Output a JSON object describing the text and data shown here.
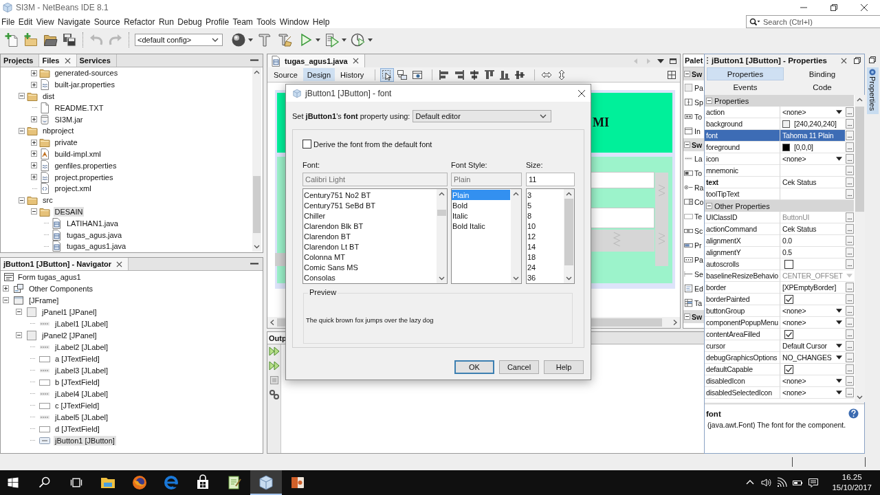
{
  "window": {
    "title": "SI3M - NetBeans IDE 8.1"
  },
  "menu": [
    "File",
    "Edit",
    "View",
    "Navigate",
    "Source",
    "Refactor",
    "Run",
    "Debug",
    "Profile",
    "Team",
    "Tools",
    "Window",
    "Help"
  ],
  "search": {
    "placeholder": "Search (Ctrl+I)"
  },
  "toolbar": {
    "groups": [
      [
        {
          "kind": "new-file",
          "disabled": false
        },
        {
          "kind": "new-project",
          "disabled": false
        },
        {
          "kind": "open-project",
          "disabled": false
        },
        {
          "kind": "save-all",
          "disabled": false
        }
      ],
      [
        {
          "kind": "undo",
          "disabled": true
        },
        {
          "kind": "redo",
          "disabled": true
        }
      ]
    ],
    "config": "<default config>",
    "tools": [
      {
        "kind": "globe",
        "menu": true
      },
      {
        "kind": "build",
        "menu": false
      },
      {
        "kind": "clean-build",
        "menu": false
      },
      {
        "kind": "run",
        "menu": true
      },
      {
        "kind": "debug",
        "menu": true
      },
      {
        "kind": "profile",
        "menu": true
      }
    ]
  },
  "projects": {
    "tabs": [
      {
        "label": "Projects",
        "selected": false,
        "closable": false
      },
      {
        "label": "Files",
        "selected": true,
        "closable": true
      },
      {
        "label": "Services",
        "selected": false,
        "closable": false
      }
    ],
    "tree": [
      {
        "children": [
          {
            "label": "generated-sources",
            "kind": "folder",
            "expanded": false,
            "selected": false
          },
          {
            "label": "built-jar.properties",
            "kind": "properties",
            "expanded": false,
            "selected": false
          }
        ]
      },
      {
        "label": "dist",
        "kind": "folder",
        "expanded": true,
        "selected": false,
        "children": [
          {
            "label": "README.TXT",
            "kind": "text",
            "selected": false
          },
          {
            "label": "SI3M.jar",
            "kind": "jar",
            "expanded": false,
            "selected": false
          }
        ]
      },
      {
        "label": "nbproject",
        "kind": "folder",
        "expanded": true,
        "selected": false,
        "children": [
          {
            "label": "private",
            "kind": "folder",
            "expanded": false,
            "selected": false
          },
          {
            "label": "build-impl.xml",
            "kind": "ant",
            "expanded": false,
            "selected": false
          },
          {
            "label": "genfiles.properties",
            "kind": "properties",
            "expanded": false,
            "selected": false
          },
          {
            "label": "project.properties",
            "kind": "properties",
            "expanded": false,
            "selected": false
          },
          {
            "label": "project.xml",
            "kind": "xml",
            "selected": false
          }
        ]
      },
      {
        "label": "src",
        "kind": "folder",
        "expanded": true,
        "selected": false,
        "children": [
          {
            "label": "DESAIN",
            "kind": "folder",
            "expanded": true,
            "selected": true,
            "children": [
              {
                "label": "LATIHAN1.java",
                "kind": "form",
                "selected": false
              },
              {
                "label": "tugas_agus.java",
                "kind": "form",
                "selected": false
              },
              {
                "label": "tugas_agus1.java",
                "kind": "form",
                "selected": false
              }
            ]
          }
        ]
      }
    ]
  },
  "navigator": {
    "title": "jButton1 [JButton] - Navigator",
    "root": {
      "label": "Form tugas_agus1",
      "kind": "nform",
      "selected": false,
      "children": [
        {
          "label": "Other Components",
          "kind": "other",
          "expanded": false,
          "selected": false
        },
        {
          "label": "[JFrame]",
          "kind": "frame",
          "expanded": true,
          "selected": false,
          "children": [
            {
              "label": "jPanel1 [JPanel]",
              "kind": "panel",
              "expanded": true,
              "selected": false,
              "children": [
                {
                  "label": "jLabel1 [JLabel]",
                  "kind": "label",
                  "selected": false
                }
              ]
            },
            {
              "label": "jPanel2 [JPanel]",
              "kind": "panel",
              "expanded": true,
              "selected": false,
              "children": [
                {
                  "label": "jLabel2 [JLabel]",
                  "kind": "label",
                  "selected": false
                },
                {
                  "label": "a [JTextField]",
                  "kind": "textfield",
                  "selected": false
                },
                {
                  "label": "jLabel3 [JLabel]",
                  "kind": "label",
                  "selected": false
                },
                {
                  "label": "b [JTextField]",
                  "kind": "textfield",
                  "selected": false
                },
                {
                  "label": "jLabel4 [JLabel]",
                  "kind": "label",
                  "selected": false
                },
                {
                  "label": "c [JTextField]",
                  "kind": "textfield",
                  "selected": false
                },
                {
                  "label": "jLabel5 [JLabel]",
                  "kind": "label",
                  "selected": false
                },
                {
                  "label": "d [JTextField]",
                  "kind": "textfield",
                  "selected": false
                },
                {
                  "label": "jButton1 [JButton]",
                  "kind": "button",
                  "selected": true
                }
              ]
            }
          ]
        }
      ]
    }
  },
  "editor": {
    "tabs": [
      {
        "label": "tugas_agus1.java",
        "selected": true
      }
    ],
    "views": [
      {
        "label": "Source",
        "selected": false
      },
      {
        "label": "Design",
        "selected": true
      },
      {
        "label": "History",
        "selected": false
      }
    ],
    "design_tools": [
      {
        "kind": "selection",
        "selected": true
      },
      {
        "kind": "connection",
        "selected": false
      },
      {
        "kind": "preview",
        "selected": false
      },
      {
        "kind": "align-left",
        "selected": false
      },
      {
        "kind": "align-right",
        "selected": false
      },
      {
        "kind": "center-h",
        "selected": false
      },
      {
        "kind": "align-top",
        "selected": false
      },
      {
        "kind": "align-bottom",
        "selected": false
      },
      {
        "kind": "center-v",
        "selected": false
      },
      {
        "kind": "resize-h",
        "selected": false
      },
      {
        "kind": "resize-v",
        "selected": false
      }
    ],
    "form": {
      "title_label": "MI"
    }
  },
  "output": {
    "tab": "Outp"
  },
  "palette": {
    "title": "Palet",
    "groups": [
      {
        "label": "Sw",
        "expanded": true,
        "items": [
          {
            "label": "Pa",
            "kind": "panel"
          },
          {
            "label": "Sp",
            "kind": "split"
          },
          {
            "label": "To",
            "kind": "toolbar"
          },
          {
            "label": "In",
            "kind": "iframe"
          }
        ]
      },
      {
        "label": "Sw",
        "expanded": true,
        "items": [
          {
            "label": "La",
            "kind": "label"
          },
          {
            "label": "To",
            "kind": "toggle"
          },
          {
            "label": "Ra",
            "kind": "radio"
          },
          {
            "label": "Co",
            "kind": "combo"
          },
          {
            "label": "Te",
            "kind": "textfield"
          },
          {
            "label": "Sc",
            "kind": "scrollbar"
          },
          {
            "label": "Pr",
            "kind": "progress"
          },
          {
            "label": "Pa",
            "kind": "password"
          },
          {
            "label": "Se",
            "kind": "separator"
          },
          {
            "label": "Ed",
            "kind": "editor"
          },
          {
            "label": "Ta",
            "kind": "table"
          }
        ]
      },
      {
        "label": "Sw",
        "expanded": true
      }
    ]
  },
  "properties": {
    "title": "jButton1 [JButton] - Properties",
    "tabs": [
      {
        "label": "Properties",
        "selected": true
      },
      {
        "label": "Binding",
        "selected": false
      },
      {
        "label": "Events",
        "selected": false
      },
      {
        "label": "Code",
        "selected": false
      }
    ],
    "sheet": [
      {
        "category": "Properties",
        "expanded": true,
        "rows": [
          {
            "name": "action",
            "kind": "dropdown",
            "value": "<none>",
            "selected": false,
            "modified": false
          },
          {
            "name": "background",
            "kind": "color",
            "value": "[240,240,240]",
            "color": "#f0f0f0",
            "selected": false,
            "modified": false
          },
          {
            "name": "font",
            "kind": "text",
            "value": "Tahoma 11 Plain",
            "selected": true,
            "modified": false
          },
          {
            "name": "foreground",
            "kind": "color",
            "value": "[0,0,0]",
            "color": "#000000",
            "selected": false,
            "modified": false
          },
          {
            "name": "icon",
            "kind": "dropdown",
            "value": "<none>",
            "selected": false,
            "modified": false
          },
          {
            "name": "mnemonic",
            "kind": "text",
            "selected": false,
            "modified": false
          },
          {
            "name": "text",
            "kind": "text",
            "value": "Cek Status",
            "selected": false,
            "modified": true
          },
          {
            "name": "toolTipText",
            "kind": "text",
            "selected": false,
            "modified": false
          }
        ]
      },
      {
        "category": "Other Properties",
        "expanded": true,
        "rows": [
          {
            "name": "UIClassID",
            "kind": "readonly",
            "value": "ButtonUI",
            "selected": false,
            "modified": false
          },
          {
            "name": "actionCommand",
            "kind": "text",
            "value": "Cek Status",
            "selected": false,
            "modified": false
          },
          {
            "name": "alignmentX",
            "kind": "text",
            "value": "0.0",
            "selected": false,
            "modified": false
          },
          {
            "name": "alignmentY",
            "kind": "text",
            "value": "0.5",
            "selected": false,
            "modified": false
          },
          {
            "name": "autoscrolls",
            "kind": "checkbox",
            "checked": false,
            "selected": false,
            "modified": false
          },
          {
            "name": "baselineResizeBehavio",
            "kind": "readonly-dropdown",
            "value": "CENTER_OFFSET",
            "selected": false,
            "modified": false
          },
          {
            "name": "border",
            "kind": "text",
            "value": "[XPEmptyBorder]",
            "selected": false,
            "modified": false
          },
          {
            "name": "borderPainted",
            "kind": "checkbox",
            "checked": true,
            "selected": false,
            "modified": false
          },
          {
            "name": "buttonGroup",
            "kind": "dropdown",
            "value": "<none>",
            "selected": false,
            "modified": false
          },
          {
            "name": "componentPopupMenu",
            "kind": "dropdown",
            "value": "<none>",
            "selected": false,
            "modified": false
          },
          {
            "name": "contentAreaFilled",
            "kind": "checkbox",
            "checked": true,
            "selected": false,
            "modified": false
          },
          {
            "name": "cursor",
            "kind": "dropdown",
            "value": "Default Cursor",
            "selected": false,
            "modified": false
          },
          {
            "name": "debugGraphicsOptions",
            "kind": "dropdown",
            "value": "NO_CHANGES",
            "selected": false,
            "modified": false
          },
          {
            "name": "defaultCapable",
            "kind": "checkbox",
            "checked": true,
            "selected": false,
            "modified": false
          },
          {
            "name": "disabledIcon",
            "kind": "dropdown",
            "value": "<none>",
            "selected": false,
            "modified": false
          },
          {
            "name": "disabledSelectedIcon",
            "kind": "dropdown",
            "value": "<none>",
            "selected": false,
            "modified": false
          }
        ]
      }
    ],
    "description": {
      "title": "font",
      "text": "(java.awt.Font) The font for the component."
    }
  },
  "side_tabs": [
    {
      "label": "Properties",
      "selected": true
    }
  ],
  "font_dialog": {
    "title": "jButton1 [JButton] - font",
    "prompt": "Set **jButton1**'s **font** property using:",
    "editor": "Default editor",
    "derive": {
      "label": "Derive the font from the default font",
      "checked": false
    },
    "columns": [
      {
        "label": "Font:",
        "value": "Calibri Light",
        "disabled": true,
        "items": [
          {
            "label": "Century751 No2 BT",
            "selected": false
          },
          {
            "label": "Century751 SeBd BT",
            "selected": false
          },
          {
            "label": "Chiller",
            "selected": false
          },
          {
            "label": "Clarendon Blk BT",
            "selected": false
          },
          {
            "label": "Clarendon BT",
            "selected": false
          },
          {
            "label": "Clarendon Lt BT",
            "selected": false
          },
          {
            "label": "Colonna MT",
            "selected": false
          },
          {
            "label": "Comic Sans MS",
            "selected": false
          },
          {
            "label": "Consolas",
            "selected": false
          }
        ]
      },
      {
        "label": "Font Style:",
        "value": "Plain",
        "disabled": true,
        "items": [
          {
            "label": "Plain",
            "selected": true
          },
          {
            "label": "Bold",
            "selected": false
          },
          {
            "label": "Italic",
            "selected": false
          },
          {
            "label": "Bold Italic",
            "selected": false
          }
        ]
      },
      {
        "label": "Size:",
        "value": "11",
        "disabled": false,
        "items": [
          {
            "label": "3",
            "selected": false
          },
          {
            "label": "5",
            "selected": false
          },
          {
            "label": "8",
            "selected": false
          },
          {
            "label": "10",
            "selected": false
          },
          {
            "label": "12",
            "selected": false
          },
          {
            "label": "14",
            "selected": false
          },
          {
            "label": "18",
            "selected": false
          },
          {
            "label": "24",
            "selected": false
          },
          {
            "label": "36",
            "selected": false
          }
        ]
      }
    ],
    "preview": {
      "label": "Preview",
      "sample": "The quick brown fox jumps over the lazy dog"
    },
    "buttons": [
      {
        "label": "OK",
        "default": true
      },
      {
        "label": "Cancel",
        "default": false
      },
      {
        "label": "Help",
        "default": false
      }
    ]
  },
  "taskbar": {
    "apps": [
      {
        "kind": "explorer",
        "selected": false
      },
      {
        "kind": "firefox",
        "selected": false
      },
      {
        "kind": "edge",
        "selected": false
      },
      {
        "kind": "store",
        "selected": false
      },
      {
        "kind": "notepad",
        "selected": false
      },
      {
        "kind": "netbeans",
        "selected": true
      },
      {
        "kind": "slides",
        "selected": false
      }
    ],
    "clock": {
      "time": "16.25",
      "date": "15/10/2017"
    }
  }
}
